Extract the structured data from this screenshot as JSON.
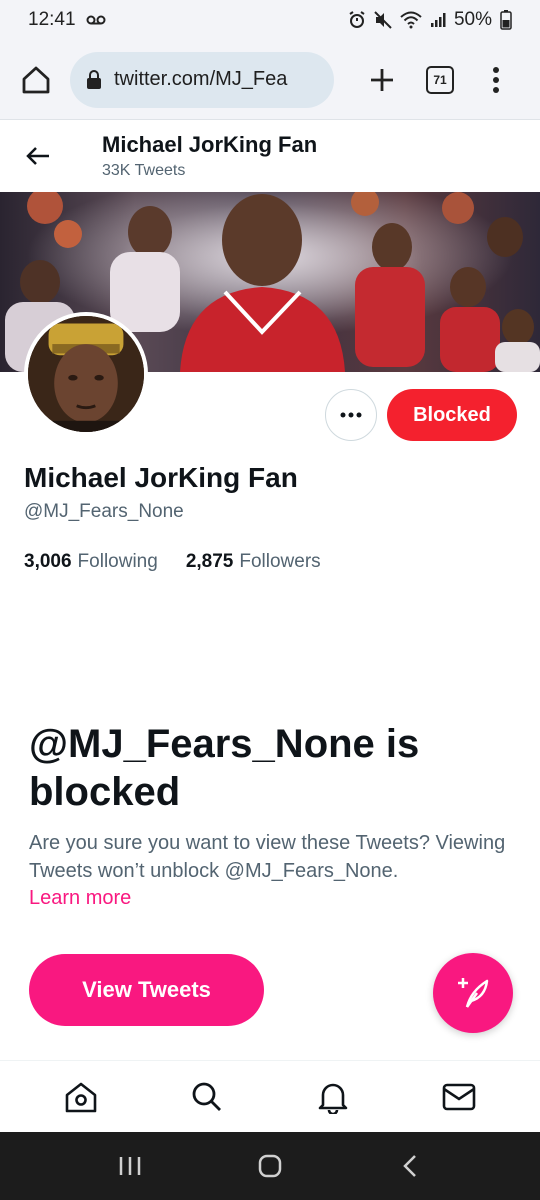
{
  "status_bar": {
    "time": "12:41",
    "battery": "50%"
  },
  "browser": {
    "url": "twitter.com/MJ_Fea",
    "tab_count": "71"
  },
  "profile": {
    "header_name": "Michael JorKing Fan",
    "tweet_count": "33K Tweets",
    "display_name": "Michael JorKing Fan",
    "handle": "@MJ_Fears_None",
    "following_count": "3,006",
    "following_label": "Following",
    "followers_count": "2,875",
    "followers_label": "Followers",
    "blocked_button": "Blocked"
  },
  "blocked_notice": {
    "title": "@MJ_Fears_None is blocked",
    "description": "Are you sure you want to view these Tweets? Viewing Tweets won’t unblock @MJ_Fears_None.",
    "learn_more": "Learn more",
    "view_tweets": "View Tweets"
  },
  "colors": {
    "accent": "#f91880",
    "blocked_red": "#f4212e",
    "secondary_text": "#536471"
  },
  "icons": {
    "status": [
      "voicemail-icon",
      "alarm-icon",
      "mute-icon",
      "wifi-icon",
      "signal-icon",
      "battery-icon"
    ],
    "browser": [
      "home-icon",
      "lock-icon",
      "plus-icon",
      "tabs-icon",
      "more-vert-icon"
    ],
    "bottom_nav": [
      "home-icon",
      "search-icon",
      "bell-icon",
      "mail-icon"
    ],
    "system_nav": [
      "recents-icon",
      "home-circle-icon",
      "back-chevron-icon"
    ]
  }
}
